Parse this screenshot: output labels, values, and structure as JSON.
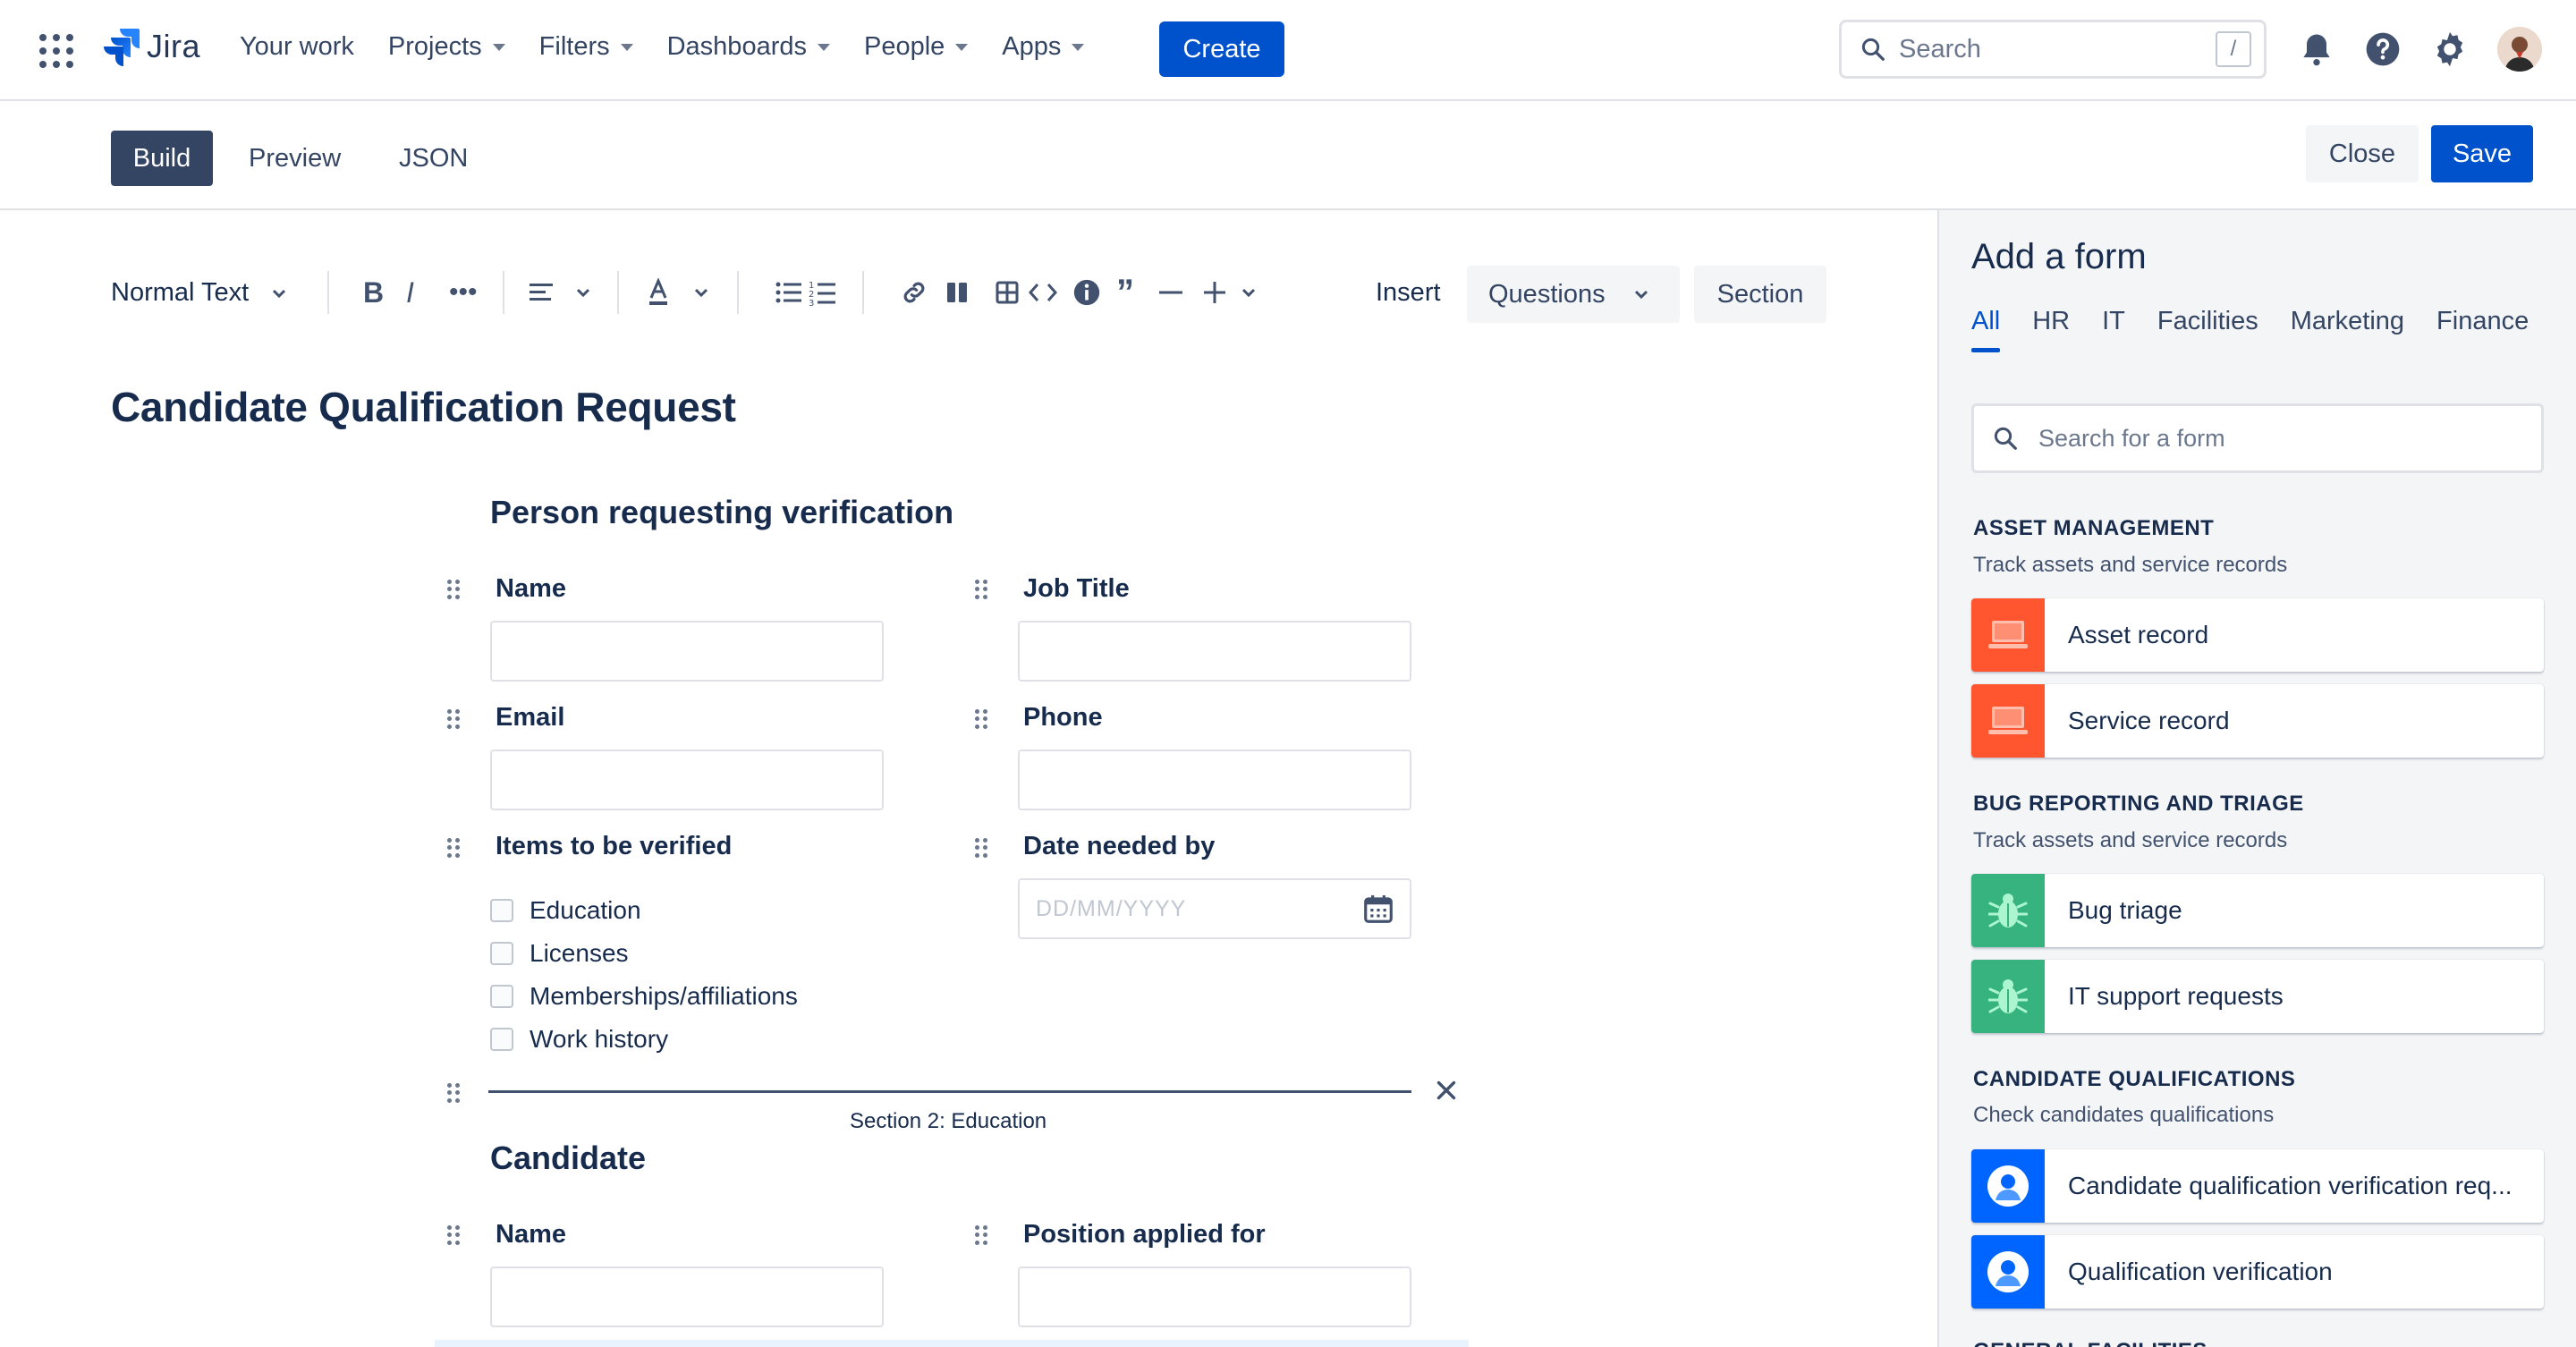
{
  "app": {
    "logo_text": "Jira"
  },
  "nav": {
    "items": [
      {
        "label": "Your work",
        "has_caret": false
      },
      {
        "label": "Projects",
        "has_caret": true
      },
      {
        "label": "Filters",
        "has_caret": true
      },
      {
        "label": "Dashboards",
        "has_caret": true
      },
      {
        "label": "People",
        "has_caret": true
      },
      {
        "label": "Apps",
        "has_caret": true
      }
    ],
    "create_label": "Create",
    "search_placeholder": "Search",
    "search_shortcut": "/"
  },
  "builder": {
    "tabs": [
      "Build",
      "Preview",
      "JSON"
    ],
    "active_tab": "Build",
    "close_label": "Close",
    "save_label": "Save"
  },
  "toolbar": {
    "text_style": "Normal Text",
    "insert_label": "Insert",
    "questions_label": "Questions",
    "section_label": "Section"
  },
  "form": {
    "title": "Candidate Qualification Request",
    "section1": {
      "title": "Person requesting verification",
      "fields": {
        "name": "Name",
        "job_title": "Job Title",
        "email": "Email",
        "phone": "Phone",
        "items": "Items to be verified",
        "date_needed": "Date needed by"
      },
      "checkboxes": [
        "Education",
        "Licenses",
        "Memberships/affiliations",
        "Work history"
      ],
      "date_placeholder": "DD/MM/YYYY"
    },
    "section_divider_label": "Section 2: Education",
    "section2": {
      "title": "Candidate",
      "fields": {
        "name": "Name",
        "position": "Position applied for"
      }
    }
  },
  "panel": {
    "title": "Add a form",
    "categories": [
      "All",
      "HR",
      "IT",
      "Facilities",
      "Marketing",
      "Finance"
    ],
    "active_category": "All",
    "search_placeholder": "Search for a form",
    "groups": [
      {
        "title": "ASSET MANAGEMENT",
        "subtitle": "Track assets and service records",
        "cards": [
          {
            "label": "Asset record",
            "icon": "laptop-icon",
            "color": "#ff5630"
          },
          {
            "label": "Service record",
            "icon": "laptop-icon",
            "color": "#ff5630"
          }
        ]
      },
      {
        "title": "BUG REPORTING AND TRIAGE",
        "subtitle": "Track assets and service records",
        "cards": [
          {
            "label": "Bug triage",
            "icon": "bug-icon",
            "color": "#36b37e"
          },
          {
            "label": "IT support requests",
            "icon": "bug-icon",
            "color": "#36b37e"
          }
        ]
      },
      {
        "title": "CANDIDATE QUALIFICATIONS",
        "subtitle": "Check candidates qualifications",
        "cards": [
          {
            "label": "Candidate qualification verification req...",
            "icon": "person-icon",
            "color": "#0065ff"
          },
          {
            "label": "Qualification verification",
            "icon": "person-icon",
            "color": "#0065ff"
          }
        ]
      }
    ],
    "next_group_title_partial": "GENERAL FACILITIES"
  },
  "colors": {
    "primary": "#0052cc",
    "text": "#172b4d",
    "border": "#dfe1e6"
  }
}
